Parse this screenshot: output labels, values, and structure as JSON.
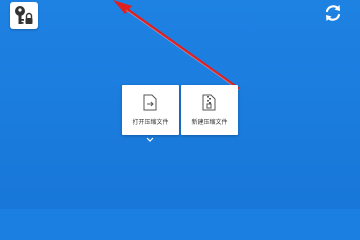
{
  "colors": {
    "background": "#1a7fe0",
    "card": "#ffffff",
    "arrow": "#e02020",
    "label_text": "#333333"
  },
  "top_left": {
    "icon": "key-lock-icon"
  },
  "top_right": {
    "icon": "refresh-icon"
  },
  "actions": [
    {
      "icon": "open-file-icon",
      "label": "打开压缩文件"
    },
    {
      "icon": "zip-file-icon",
      "label": "新建压缩文件"
    }
  ],
  "expand": {
    "icon": "chevron-down-icon"
  }
}
